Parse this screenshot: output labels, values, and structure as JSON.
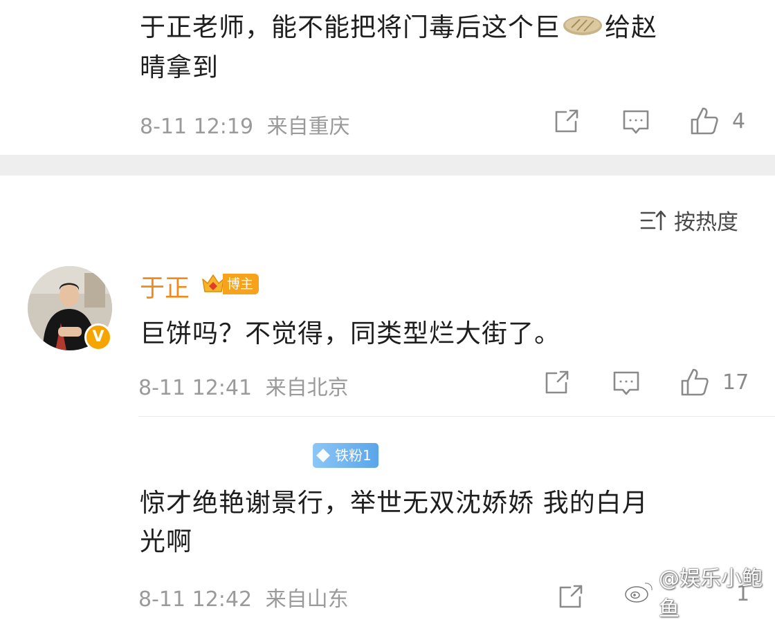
{
  "comments": [
    {
      "text_line1": "于正老师，能不能把将门毒后这个巨",
      "text_line1_end": "给赵",
      "text_line2": "晴拿到",
      "inline_emoji": "pancake-emoji",
      "time": "8-11 12:19",
      "location": "来自重庆",
      "likes": "4"
    },
    {
      "username": "于正",
      "badge": "博主",
      "text": "巨饼吗？不觉得，同类型烂大街了。",
      "time": "8-11 12:41",
      "location": "来自北京",
      "likes": "17"
    },
    {
      "fan_badge": "铁粉1",
      "text_line1": "惊才绝艳谢景行，举世无双沈娇娇 我的白月",
      "text_line2": "光啊",
      "time": "8-11 12:42",
      "location": "来自山东",
      "likes": "1"
    }
  ],
  "sort": {
    "label": "按热度",
    "icon": "sort-icon"
  },
  "watermark": "@娱乐小鲍鱼",
  "colors": {
    "username": "#f08a1a",
    "meta": "#9a9a9a",
    "background": "#ffffff",
    "separator": "#eeeeee",
    "verified_badge": "#f6a400",
    "fan_badge": "#5aa5ea"
  }
}
